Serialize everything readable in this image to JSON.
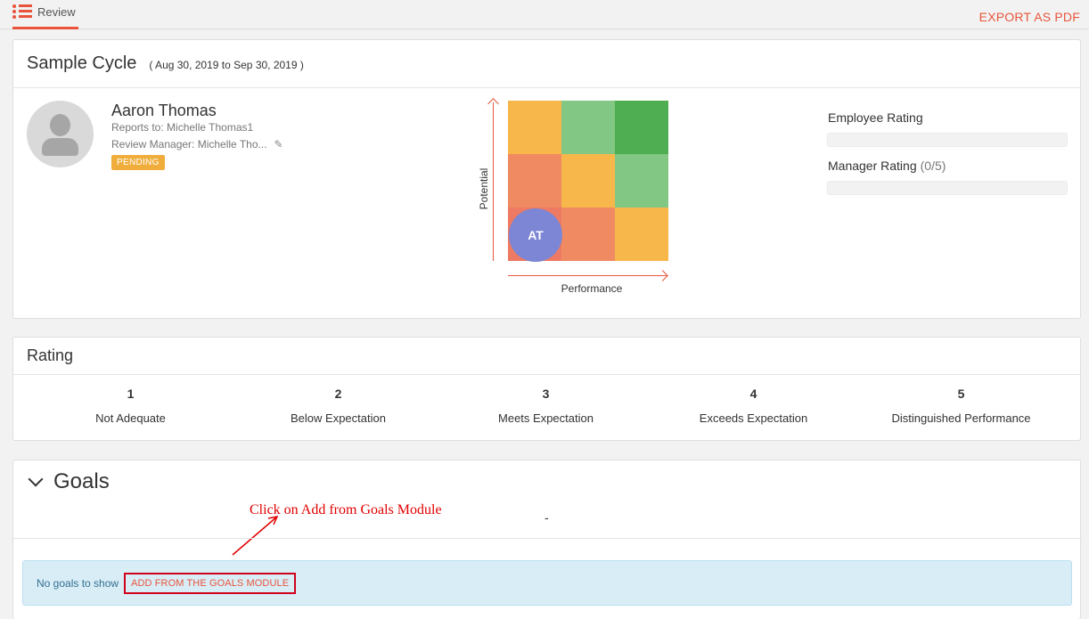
{
  "topbar": {
    "tab_label": "Review",
    "export_label": "EXPORT AS PDF"
  },
  "cycle": {
    "title": "Sample Cycle",
    "dates": "( Aug 30, 2019 to Sep 30, 2019 )"
  },
  "employee": {
    "name": "Aaron Thomas",
    "reports_to": "Reports to: Michelle Thomas1",
    "review_manager": "Review Manager: Michelle Tho...",
    "status": "PENDING"
  },
  "ninebox": {
    "initials": "AT",
    "y_label": "Potential",
    "x_label": "Performance",
    "cell_colors": [
      "#f8b74b",
      "#82c784",
      "#4fae52",
      "#f08a62",
      "#f8b74b",
      "#82c784",
      "#ee7a64",
      "#f08a62",
      "#f8b74b"
    ]
  },
  "ratings": {
    "employee_label": "Employee Rating",
    "manager_label": "Manager Rating",
    "manager_count": "(0/5)"
  },
  "rating_section": {
    "title": "Rating",
    "scale": [
      {
        "num": "1",
        "text": "Not Adequate"
      },
      {
        "num": "2",
        "text": "Below Expectation"
      },
      {
        "num": "3",
        "text": "Meets Expectation"
      },
      {
        "num": "4",
        "text": "Exceeds Expectation"
      },
      {
        "num": "5",
        "text": "Distinguished Performance"
      }
    ]
  },
  "goals": {
    "title": "Goals",
    "dash": "-",
    "empty_text": "No goals to show",
    "add_label": "ADD FROM THE GOALS MODULE",
    "annotation": "Click on Add from Goals Module"
  },
  "colors": {
    "accent": "#e8553c",
    "annotation": "#e00000"
  }
}
